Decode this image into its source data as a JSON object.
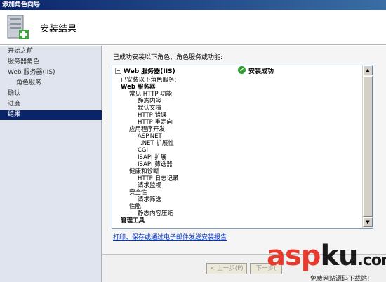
{
  "window": {
    "title": "添加角色向导"
  },
  "header": {
    "title": "安装结果",
    "icon": "server-install-icon"
  },
  "sidebar": {
    "steps": [
      {
        "label": "开始之前"
      },
      {
        "label": "服务器角色"
      },
      {
        "label": "Web 服务器(IIS)"
      },
      {
        "label": "角色服务"
      },
      {
        "label": "确认"
      },
      {
        "label": "进度"
      },
      {
        "label": "结果"
      }
    ]
  },
  "main": {
    "intro": "已成功安装以下角色、角色服务或功能:",
    "role": {
      "title": "Web 服务器(IIS)",
      "status": "安装成功",
      "collapse_symbol": "−",
      "check_symbol": "✔"
    },
    "tree": [
      {
        "text": "已安装以下角色服务:"
      },
      {
        "text": "Web 服务器"
      },
      {
        "text": "常见 HTTP 功能"
      },
      {
        "text": "静态内容"
      },
      {
        "text": "默认文档"
      },
      {
        "text": "HTTP 错误"
      },
      {
        "text": "HTTP 重定向"
      },
      {
        "text": "应用程序开发"
      },
      {
        "text": "ASP.NET"
      },
      {
        "text": ".NET 扩展性"
      },
      {
        "text": "CGI"
      },
      {
        "text": "ISAPI 扩展"
      },
      {
        "text": "ISAPI 筛选器"
      },
      {
        "text": "健康和诊断"
      },
      {
        "text": "HTTP 日志记录"
      },
      {
        "text": "请求监视"
      },
      {
        "text": "安全性"
      },
      {
        "text": "请求筛选"
      },
      {
        "text": "性能"
      },
      {
        "text": "静态内容压缩"
      },
      {
        "text": "管理工具"
      }
    ],
    "report_link": "打印、保存或通过电子邮件发送安装报告"
  },
  "footer": {
    "prev": "< 上一步(P)",
    "next": "下一步("
  },
  "watermark": {
    "brand_main": "asp",
    "brand_ku": "ku",
    "brand_com": ".com",
    "tagline": "免费网站源码下载站!"
  }
}
